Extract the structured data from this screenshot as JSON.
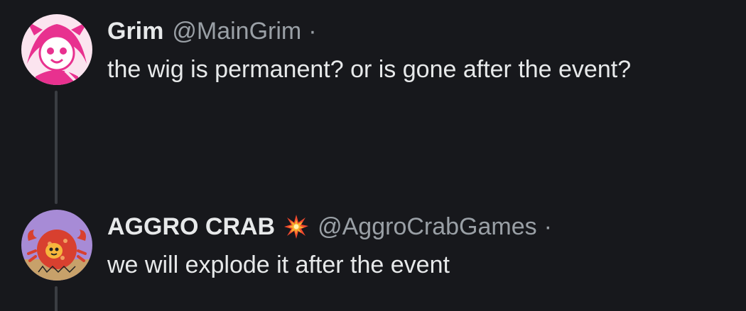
{
  "tweets": [
    {
      "display_name": "Grim",
      "handle": "@MainGrim",
      "separator": "·",
      "text": "the wig is permanent? or is gone after the event?",
      "avatar_icon": "anime-character-avatar",
      "avatar_color": "#e8318f"
    },
    {
      "display_name": "AGGRO CRAB",
      "badge_icon": "explosion-emoji-icon",
      "handle": "@AggroCrabGames",
      "separator": "·",
      "text": "we will explode it after the event",
      "avatar_icon": "crab-avatar",
      "avatar_color": "#a78bd6"
    }
  ],
  "colors": {
    "background": "#17181c",
    "primary_text": "#e7e9ea",
    "secondary_text": "#9aa0a6",
    "thread_line": "#3a3d42"
  }
}
